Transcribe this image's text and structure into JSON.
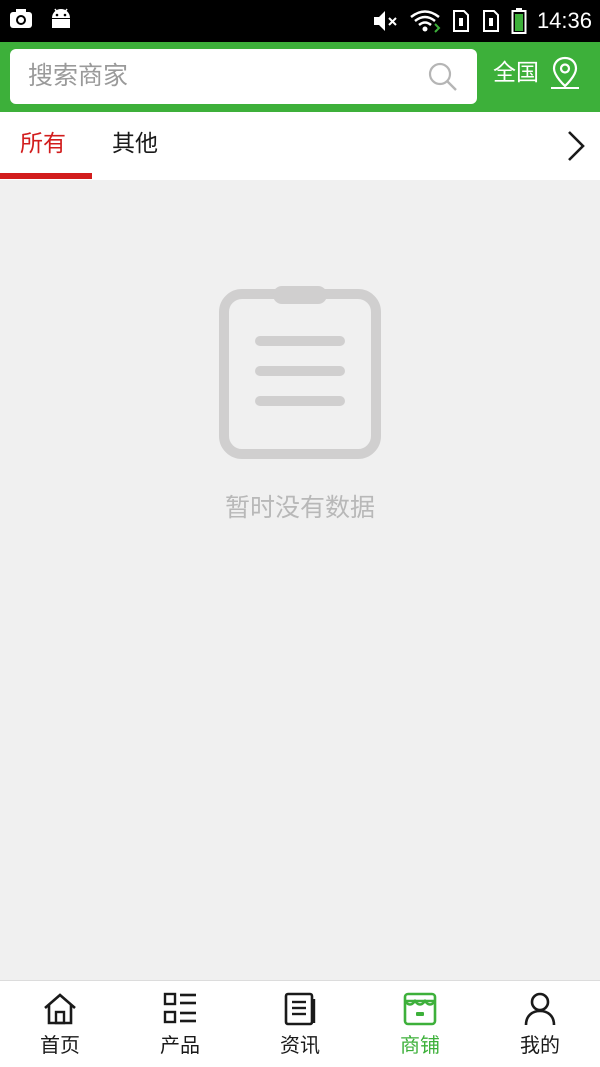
{
  "status_bar": {
    "time": "14:36",
    "left_icons": [
      "screenshot-icon",
      "android-icon"
    ],
    "right_icons": [
      "mute-icon",
      "wifi-icon",
      "sim1-icon",
      "sim2-icon",
      "battery-icon"
    ]
  },
  "header": {
    "search_placeholder": "搜索商家",
    "region_label": "全国",
    "colors": {
      "bar": "#3db03a"
    }
  },
  "tabs": {
    "items": [
      {
        "label": "所有",
        "active": true
      },
      {
        "label": "其他",
        "active": false
      }
    ],
    "more_icon": "chevron-right-icon",
    "colors": {
      "active": "#d21d1d"
    }
  },
  "empty_state": {
    "icon": "clipboard-icon",
    "message": "暂时没有数据"
  },
  "bottom_nav": {
    "items": [
      {
        "label": "首页",
        "icon": "home-icon",
        "active": false
      },
      {
        "label": "产品",
        "icon": "list-icon",
        "active": false
      },
      {
        "label": "资讯",
        "icon": "news-icon",
        "active": false
      },
      {
        "label": "商铺",
        "icon": "store-icon",
        "active": true
      },
      {
        "label": "我的",
        "icon": "user-icon",
        "active": false
      }
    ],
    "colors": {
      "active": "#3db03a",
      "inactive": "#1a1a1a"
    }
  }
}
